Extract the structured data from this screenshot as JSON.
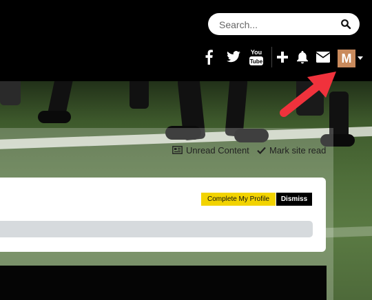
{
  "search": {
    "placeholder": "Search..."
  },
  "header_icons": [
    "facebook-icon",
    "twitter-icon",
    "youtube-icon",
    "plus-icon",
    "bell-icon",
    "envelope-icon"
  ],
  "youtube_icon_text": {
    "you": "You",
    "tube": "Tube"
  },
  "user": {
    "avatar_letter": "M",
    "avatar_color": "#c98a5c"
  },
  "annotation": {
    "arrow_color": "#f0323c"
  },
  "quick_links": {
    "unread": "Unread Content",
    "mark_read": "Mark site read"
  },
  "profile_prompt": {
    "complete_label": "Complete My Profile",
    "dismiss_label": "Dismiss",
    "accent": "#f2d300",
    "progress": 0
  }
}
